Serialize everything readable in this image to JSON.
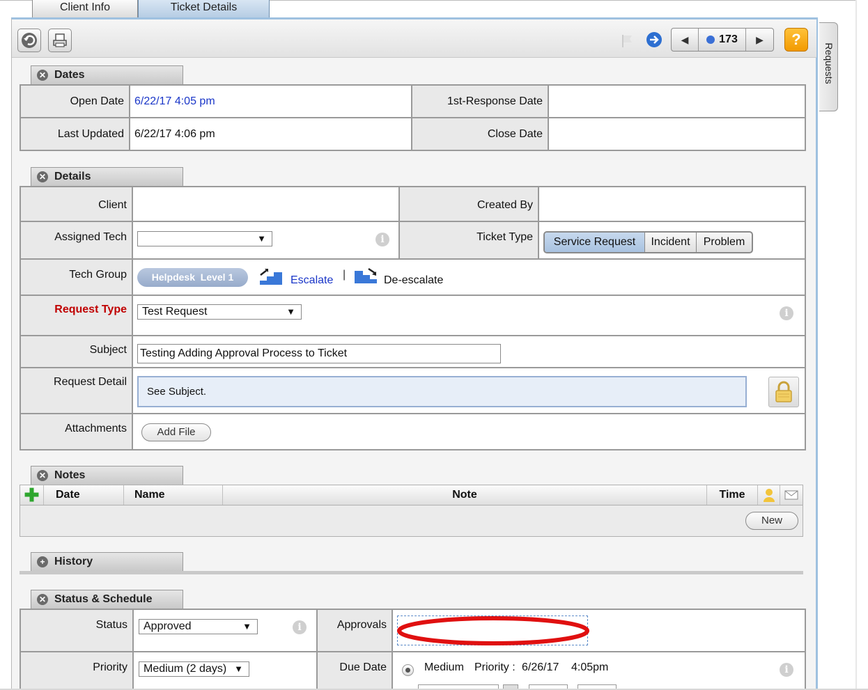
{
  "tabs": [
    {
      "label": "Client Info",
      "active": false
    },
    {
      "label": "Ticket Details",
      "active": true
    }
  ],
  "toolbar": {
    "back_icon": "back-arrow-icon",
    "print_icon": "print-icon",
    "flag_icon": "flag-icon",
    "next_icon": "arrow-right-circle-icon",
    "ticket_number": "173",
    "help_label": "?"
  },
  "side_tab": {
    "label": "Requests"
  },
  "dates": {
    "title": "Dates",
    "open_date_label": "Open Date",
    "open_date_value": "6/22/17 4:05 pm",
    "first_response_label": "1st-Response Date",
    "first_response_value": "",
    "last_updated_label": "Last Updated",
    "last_updated_value": "6/22/17 4:06 pm",
    "close_date_label": "Close Date",
    "close_date_value": ""
  },
  "details": {
    "title": "Details",
    "client_label": "Client",
    "client_value": "",
    "created_by_label": "Created By",
    "created_by_value": "",
    "assigned_tech_label": "Assigned Tech",
    "assigned_tech_value": "",
    "ticket_type_label": "Ticket Type",
    "ticket_types": [
      "Service Request",
      "Incident",
      "Problem"
    ],
    "ticket_type_selected": "Service Request",
    "tech_group_label": "Tech Group",
    "tech_group_value": "Helpdesk  Level 1",
    "escalate_label": "Escalate",
    "separator": "|",
    "deescalate_label": "De-escalate",
    "request_type_label": "Request Type",
    "request_type_value": "Test Request",
    "subject_label": "Subject",
    "subject_value": "Testing Adding Approval Process to Ticket",
    "request_detail_label": "Request Detail",
    "request_detail_value": "See Subject.",
    "attachments_label": "Attachments",
    "add_file_label": "Add File"
  },
  "notes": {
    "title": "Notes",
    "columns": [
      "Date",
      "Name",
      "Note",
      "Time"
    ],
    "new_label": "New"
  },
  "history": {
    "title": "History"
  },
  "status_schedule": {
    "title": "Status & Schedule",
    "status_label": "Status",
    "status_value": "Approved",
    "approvals_label": "Approvals",
    "priority_label": "Priority",
    "priority_value": "Medium (2 days)",
    "due_date_label": "Due Date",
    "due_priority_name": "Medium",
    "due_priority_text": "Priority :",
    "due_date_value": "6/26/17",
    "due_time_value": "4:05pm"
  },
  "colors": {
    "accent_blue": "#9fc1e0",
    "link_blue": "#1a36c8",
    "required_red": "#c00000",
    "annotation_red": "#e01010"
  }
}
